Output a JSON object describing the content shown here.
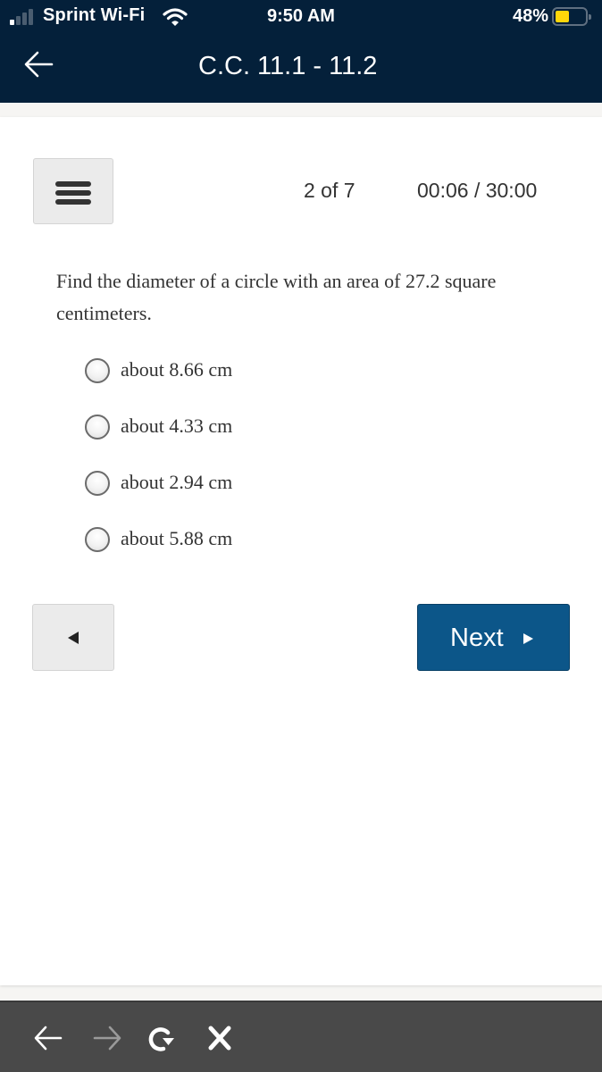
{
  "status_bar": {
    "carrier": "Sprint Wi-Fi",
    "time": "9:50 AM",
    "battery_percent": "48%",
    "battery_level": 0.48,
    "signal_bars_active": 1,
    "signal_bars_total": 4,
    "icons": [
      "signal-icon",
      "wifi-icon",
      "battery-icon"
    ]
  },
  "navbar": {
    "back_icon": "arrow-left-icon",
    "title": "C.C. 11.1 - 11.2"
  },
  "quiz": {
    "menu_icon": "hamburger-menu-icon",
    "counter": "2 of 7",
    "timer": "00:06 / 30:00",
    "question": "Find the diameter of a circle with an area of 27.2 square centimeters.",
    "options": [
      {
        "label": "about 8.66 cm",
        "selected": false
      },
      {
        "label": "about 4.33 cm",
        "selected": false
      },
      {
        "label": "about 2.94 cm",
        "selected": false
      },
      {
        "label": "about 5.88 cm",
        "selected": false
      }
    ],
    "prev_icon": "triangle-left-icon",
    "next_label": "Next",
    "next_icon": "triangle-right-icon"
  },
  "colors": {
    "header_bg": "#04203a",
    "next_button": "#0c5689",
    "battery_fill": "#ffd60a",
    "bottom_bar": "#494949"
  },
  "browser_bar": {
    "icons": [
      "back-arrow-icon",
      "forward-arrow-icon",
      "reload-icon",
      "close-icon"
    ]
  }
}
